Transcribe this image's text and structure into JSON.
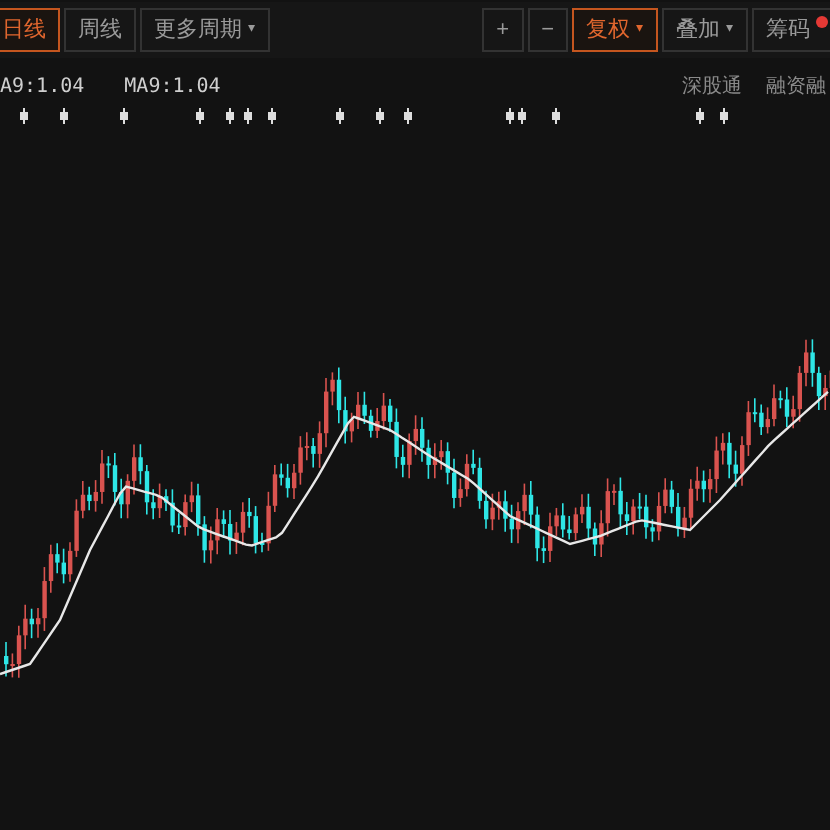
{
  "toolbar": {
    "period_tabs": [
      {
        "label": "日线",
        "selected": true
      },
      {
        "label": "周线",
        "selected": false
      },
      {
        "label": "更多周期",
        "selected": false,
        "caret": "▾"
      }
    ],
    "tools": [
      {
        "label": "+",
        "selected": false
      },
      {
        "label": "−",
        "selected": false
      },
      {
        "label": "复权",
        "selected": true,
        "caret": "▾"
      },
      {
        "label": "叠加",
        "selected": false,
        "caret": "▾"
      },
      {
        "label": "筹码",
        "selected": false,
        "badge": true
      }
    ]
  },
  "indicators": [
    {
      "label": "A9:1.04"
    },
    {
      "label": "MA9:1.04"
    }
  ],
  "links": [
    {
      "label": "深股通"
    },
    {
      "label": "融资融"
    }
  ]
}
